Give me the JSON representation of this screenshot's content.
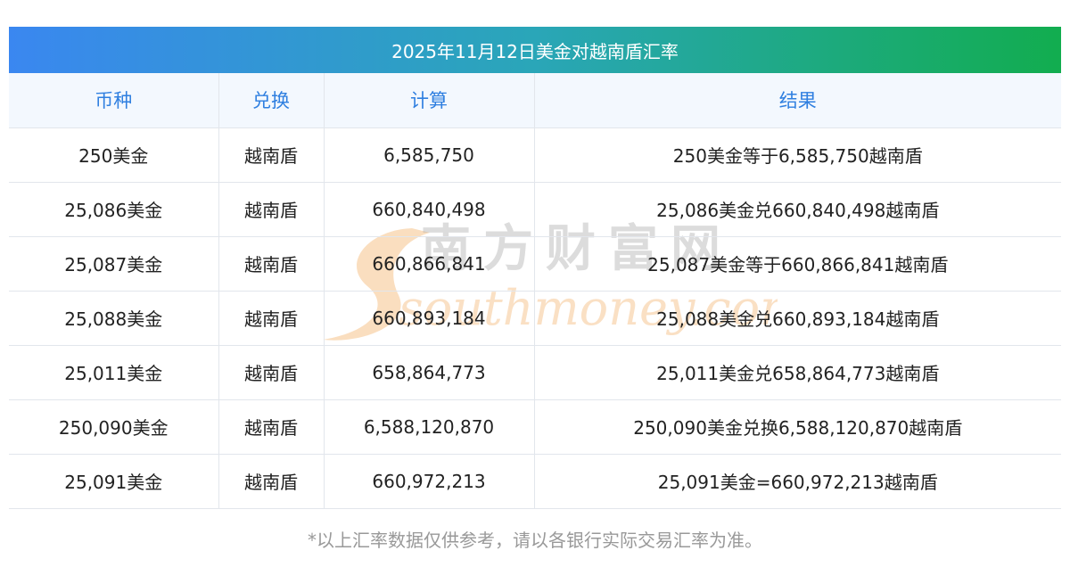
{
  "title": "2025年11月12日美金对越南盾汇率",
  "headers": [
    "币种",
    "兑换",
    "计算",
    "结果"
  ],
  "rows": [
    [
      "250美金",
      "越南盾",
      "6,585,750",
      "250美金等于6,585,750越南盾"
    ],
    [
      "25,086美金",
      "越南盾",
      "660,840,498",
      "25,086美金兑660,840,498越南盾"
    ],
    [
      "25,087美金",
      "越南盾",
      "660,866,841",
      "25,087美金等于660,866,841越南盾"
    ],
    [
      "25,088美金",
      "越南盾",
      "660,893,184",
      "25,088美金兑660,893,184越南盾"
    ],
    [
      "25,011美金",
      "越南盾",
      "658,864,773",
      "25,011美金兑658,864,773越南盾"
    ],
    [
      "250,090美金",
      "越南盾",
      "6,588,120,870",
      "250,090美金兑换6,588,120,870越南盾"
    ],
    [
      "25,091美金",
      "越南盾",
      "660,972,213",
      "25,091美金=660,972,213越南盾"
    ]
  ],
  "watermark": {
    "cn": "南方财富网",
    "en": "southmoney.com",
    "color": "#f6c28a"
  },
  "footnote": "*以上汇率数据仅供参考，请以各银行实际交易汇率为准。"
}
